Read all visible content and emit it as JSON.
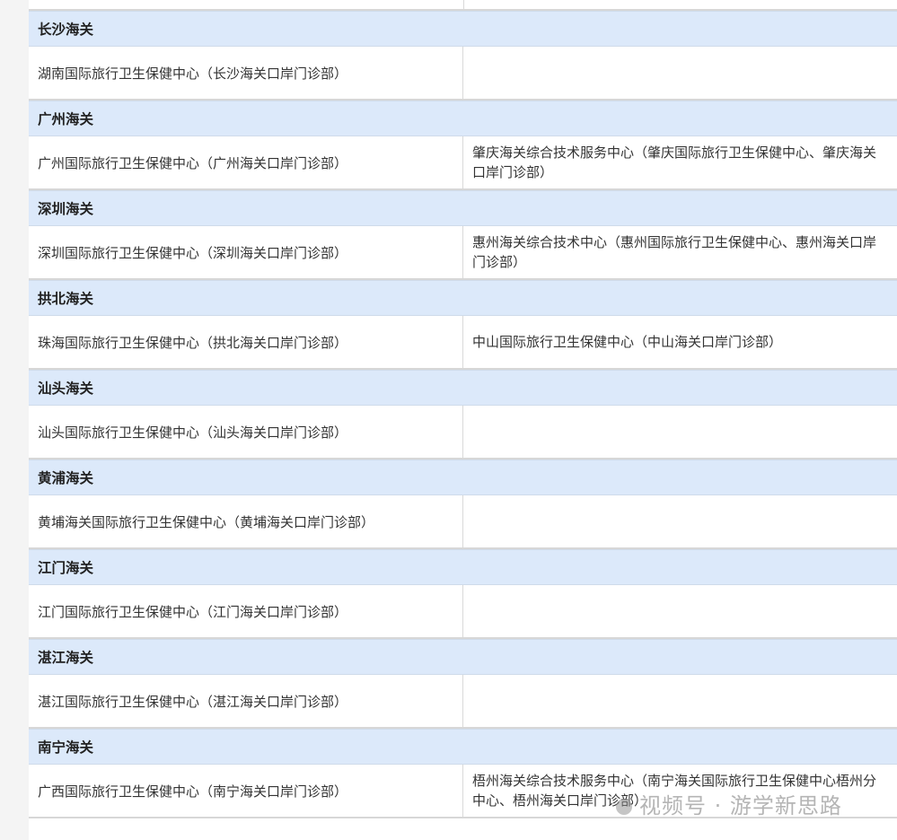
{
  "groups": [
    {
      "header": "长沙海关",
      "left": "湖南国际旅行卫生保健中心（长沙海关口岸门诊部）",
      "right": ""
    },
    {
      "header": "广州海关",
      "left": "广州国际旅行卫生保健中心（广州海关口岸门诊部）",
      "right": "肇庆海关综合技术服务中心（肇庆国际旅行卫生保健中心、肇庆海关口岸门诊部）"
    },
    {
      "header": "深圳海关",
      "left": "深圳国际旅行卫生保健中心（深圳海关口岸门诊部）",
      "right": "惠州海关综合技术中心（惠州国际旅行卫生保健中心、惠州海关口岸门诊部）"
    },
    {
      "header": "拱北海关",
      "left": "珠海国际旅行卫生保健中心（拱北海关口岸门诊部）",
      "right": "中山国际旅行卫生保健中心（中山海关口岸门诊部）"
    },
    {
      "header": "汕头海关",
      "left": "汕头国际旅行卫生保健中心（汕头海关口岸门诊部）",
      "right": ""
    },
    {
      "header": "黄浦海关",
      "left": "黄埔海关国际旅行卫生保健中心（黄埔海关口岸门诊部）",
      "right": ""
    },
    {
      "header": "江门海关",
      "left": "江门国际旅行卫生保健中心（江门海关口岸门诊部）",
      "right": ""
    },
    {
      "header": "湛江海关",
      "left": "湛江国际旅行卫生保健中心（湛江海关口岸门诊部）",
      "right": ""
    },
    {
      "header": "南宁海关",
      "left": "广西国际旅行卫生保健中心（南宁海关口岸门诊部）",
      "right": "梧州海关综合技术服务中心（南宁海关国际旅行卫生保健中心梧州分中心、梧州海关口岸门诊部）"
    }
  ],
  "watermark": {
    "text": "视频号 · 游学新思路",
    "icon": "wechat-channels-icon"
  }
}
